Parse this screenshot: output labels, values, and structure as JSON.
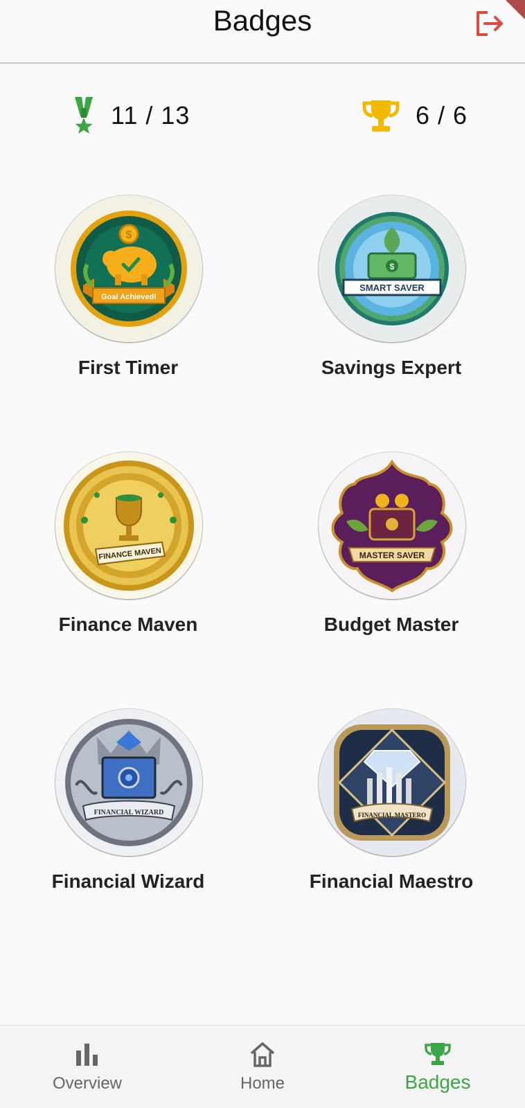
{
  "header": {
    "title": "Badges",
    "logout_icon": "logout-icon",
    "accent": "#e04a3c"
  },
  "stats": {
    "badges": {
      "icon": "medal-icon",
      "text": "11 / 13",
      "color": "#3ca545"
    },
    "trophies": {
      "icon": "trophy-icon",
      "text": "6 / 6",
      "color": "#f5b800"
    }
  },
  "badges": [
    {
      "label": "First Timer",
      "banner": "Goal Achieved!"
    },
    {
      "label": "Savings Expert",
      "banner": "SMART SAVER"
    },
    {
      "label": "Finance Maven",
      "banner": "FINANCE MAVEN"
    },
    {
      "label": "Budget Master",
      "banner": "MASTER SAVER"
    },
    {
      "label": "Financial Wizard",
      "banner": "FINANCIAL WIZARD"
    },
    {
      "label": "Financial Maestro",
      "banner": "FINANCIAL MASTERO"
    }
  ],
  "nav": {
    "items": [
      {
        "label": "Overview",
        "icon": "bar-chart-icon"
      },
      {
        "label": "Home",
        "icon": "home-icon"
      },
      {
        "label": "Badges",
        "icon": "trophy-icon",
        "active": true
      }
    ],
    "active_color": "#3ca545",
    "inactive_color": "#666666"
  }
}
